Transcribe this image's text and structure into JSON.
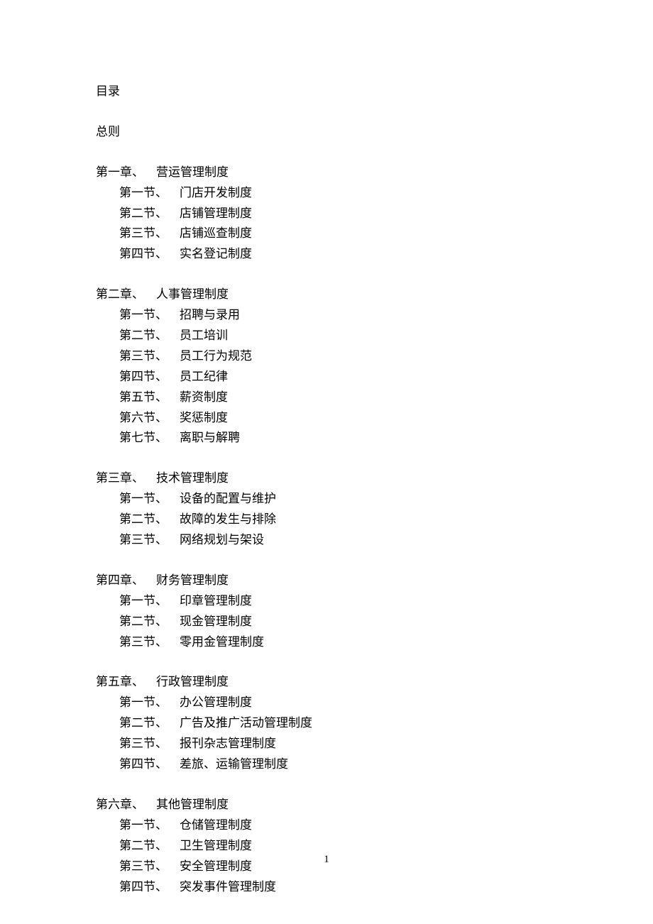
{
  "toc_heading": "目录",
  "general_heading": "总则",
  "chapters": [
    {
      "label": "第一章、",
      "title": "营运管理制度",
      "sections": [
        {
          "label": "第一节、",
          "title": "门店开发制度"
        },
        {
          "label": "第二节、",
          "title": "店铺管理制度"
        },
        {
          "label": "第三节、",
          "title": "店铺巡查制度"
        },
        {
          "label": "第四节、",
          "title": "实名登记制度"
        }
      ]
    },
    {
      "label": "第二章、",
      "title": "人事管理制度",
      "sections": [
        {
          "label": "第一节、",
          "title": "招聘与录用"
        },
        {
          "label": "第二节、",
          "title": "员工培训"
        },
        {
          "label": "第三节、",
          "title": "员工行为规范"
        },
        {
          "label": "第四节、",
          "title": "员工纪律"
        },
        {
          "label": "第五节、",
          "title": "薪资制度"
        },
        {
          "label": "第六节、",
          "title": "奖惩制度"
        },
        {
          "label": "第七节、",
          "title": "离职与解聘"
        }
      ]
    },
    {
      "label": "第三章、",
      "title": "技术管理制度",
      "sections": [
        {
          "label": "第一节、",
          "title": "设备的配置与维护"
        },
        {
          "label": "第二节、",
          "title": "故障的发生与排除"
        },
        {
          "label": "第三节、",
          "title": "网络规划与架设"
        }
      ]
    },
    {
      "label": "第四章、",
      "title": "财务管理制度",
      "sections": [
        {
          "label": "第一节、",
          "title": "印章管理制度"
        },
        {
          "label": "第二节、",
          "title": "现金管理制度"
        },
        {
          "label": "第三节、",
          "title": "零用金管理制度"
        }
      ]
    },
    {
      "label": "第五章、",
      "title": "行政管理制度",
      "sections": [
        {
          "label": "第一节、",
          "title": "办公管理制度"
        },
        {
          "label": "第二节、",
          "title": "广告及推广活动管理制度"
        },
        {
          "label": "第三节、",
          "title": "报刊杂志管理制度"
        },
        {
          "label": "第四节、",
          "title": "差旅、运输管理制度"
        }
      ]
    },
    {
      "label": "第六章、",
      "title": "其他管理制度",
      "sections": [
        {
          "label": "第一节、",
          "title": "仓储管理制度"
        },
        {
          "label": "第二节、",
          "title": "卫生管理制度"
        },
        {
          "label": "第三节、",
          "title": "安全管理制度"
        },
        {
          "label": "第四节、",
          "title": "突发事件管理制度"
        }
      ]
    }
  ],
  "page_number": "1"
}
